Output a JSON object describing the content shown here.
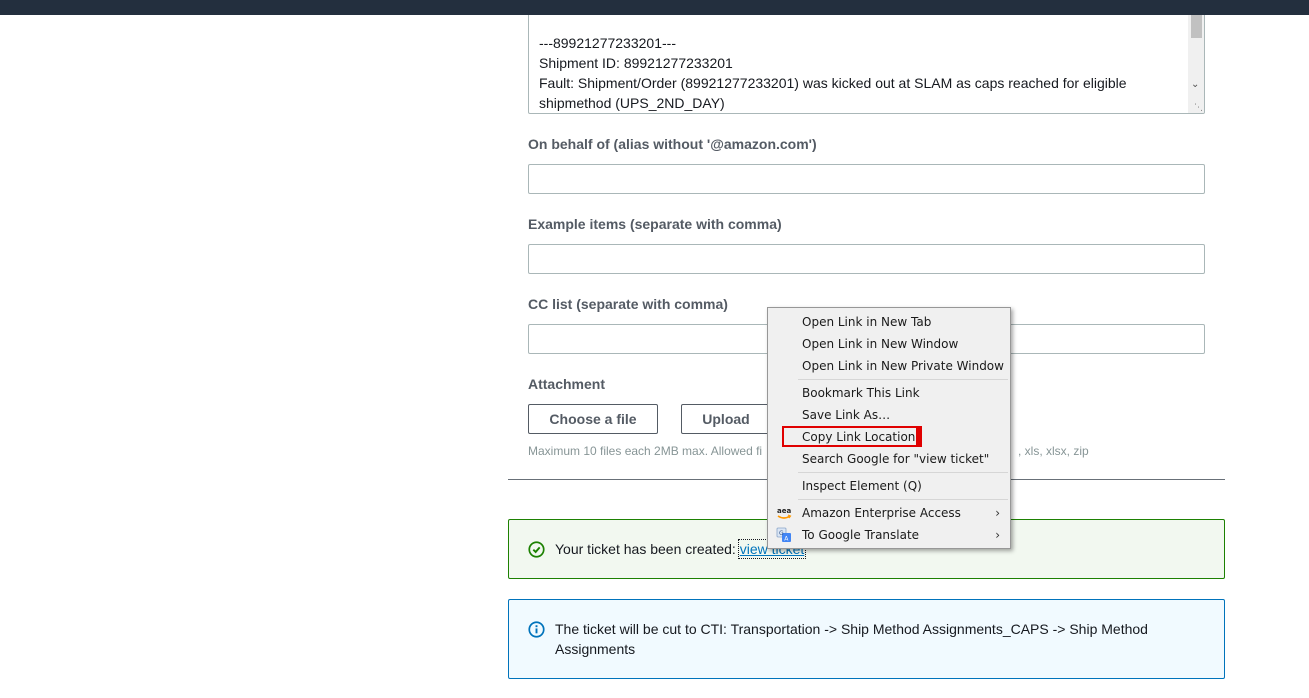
{
  "description_box": {
    "lines": [
      "---89921277233201---",
      "Shipment ID: 89921277233201",
      "Fault: Shipment/Order (89921277233201) was kicked out at SLAM as caps reached for eligible",
      "shipmethod (UPS_2ND_DAY)"
    ]
  },
  "form": {
    "on_behalf_label": "On behalf of (alias without '@amazon.com')",
    "on_behalf_value": "",
    "example_items_label": "Example items (separate with comma)",
    "example_items_value": "",
    "cc_list_label": "CC list (separate with comma)",
    "cc_list_value": "",
    "attachment_label": "Attachment",
    "choose_file_label": "Choose a file",
    "upload_label": "Upload",
    "attachment_hint": "Maximum 10 files each 2MB max. Allowed fi",
    "attachment_hint_tail": ", xls, xlsx, zip"
  },
  "alerts": {
    "success_text": "Your ticket has been created: ",
    "success_link": "view ticket",
    "info_text": "The ticket will be cut to CTI: Transportation -> Ship Method Assignments_CAPS -> Ship Method Assignments"
  },
  "context_menu": {
    "items": [
      {
        "label": "Open Link in New Tab"
      },
      {
        "label": "Open Link in New Window"
      },
      {
        "label": "Open Link in New Private Window"
      },
      {
        "label": "Bookmark This Link"
      },
      {
        "label": "Save Link As…"
      },
      {
        "label": "Copy Link Location"
      },
      {
        "label": "Search Google for \"view ticket\""
      },
      {
        "label": "Inspect Element (Q)"
      },
      {
        "label": "Amazon Enterprise Access",
        "icon": "amazon-icon"
      },
      {
        "label": "To Google Translate",
        "icon": "translate-icon"
      }
    ]
  },
  "colors": {
    "topbar": "#232f3e",
    "success_border": "#1d8102",
    "info_border": "#0073bb",
    "highlight": "#e00000",
    "link": "#0073bb"
  }
}
